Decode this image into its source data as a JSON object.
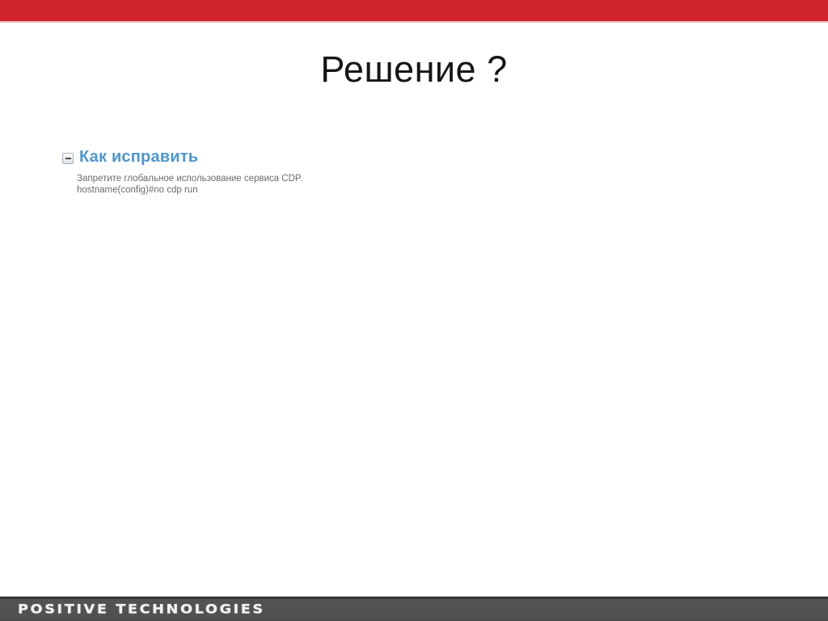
{
  "slide": {
    "title": "Решение ?"
  },
  "content": {
    "section_heading": "Как исправить",
    "body_lines": [
      "Запретите глобальное использование сервиса CDP.",
      "hostname(config)#no cdp run"
    ]
  },
  "footer": {
    "logo_text": "POSITIVE TECHNOLOGIES"
  },
  "colors": {
    "accent_red": "#d0232b",
    "heading_blue": "#4e96d2",
    "body_text_gray": "#6b6b6b",
    "footer_gray": "#515153",
    "title_black": "#161616"
  }
}
